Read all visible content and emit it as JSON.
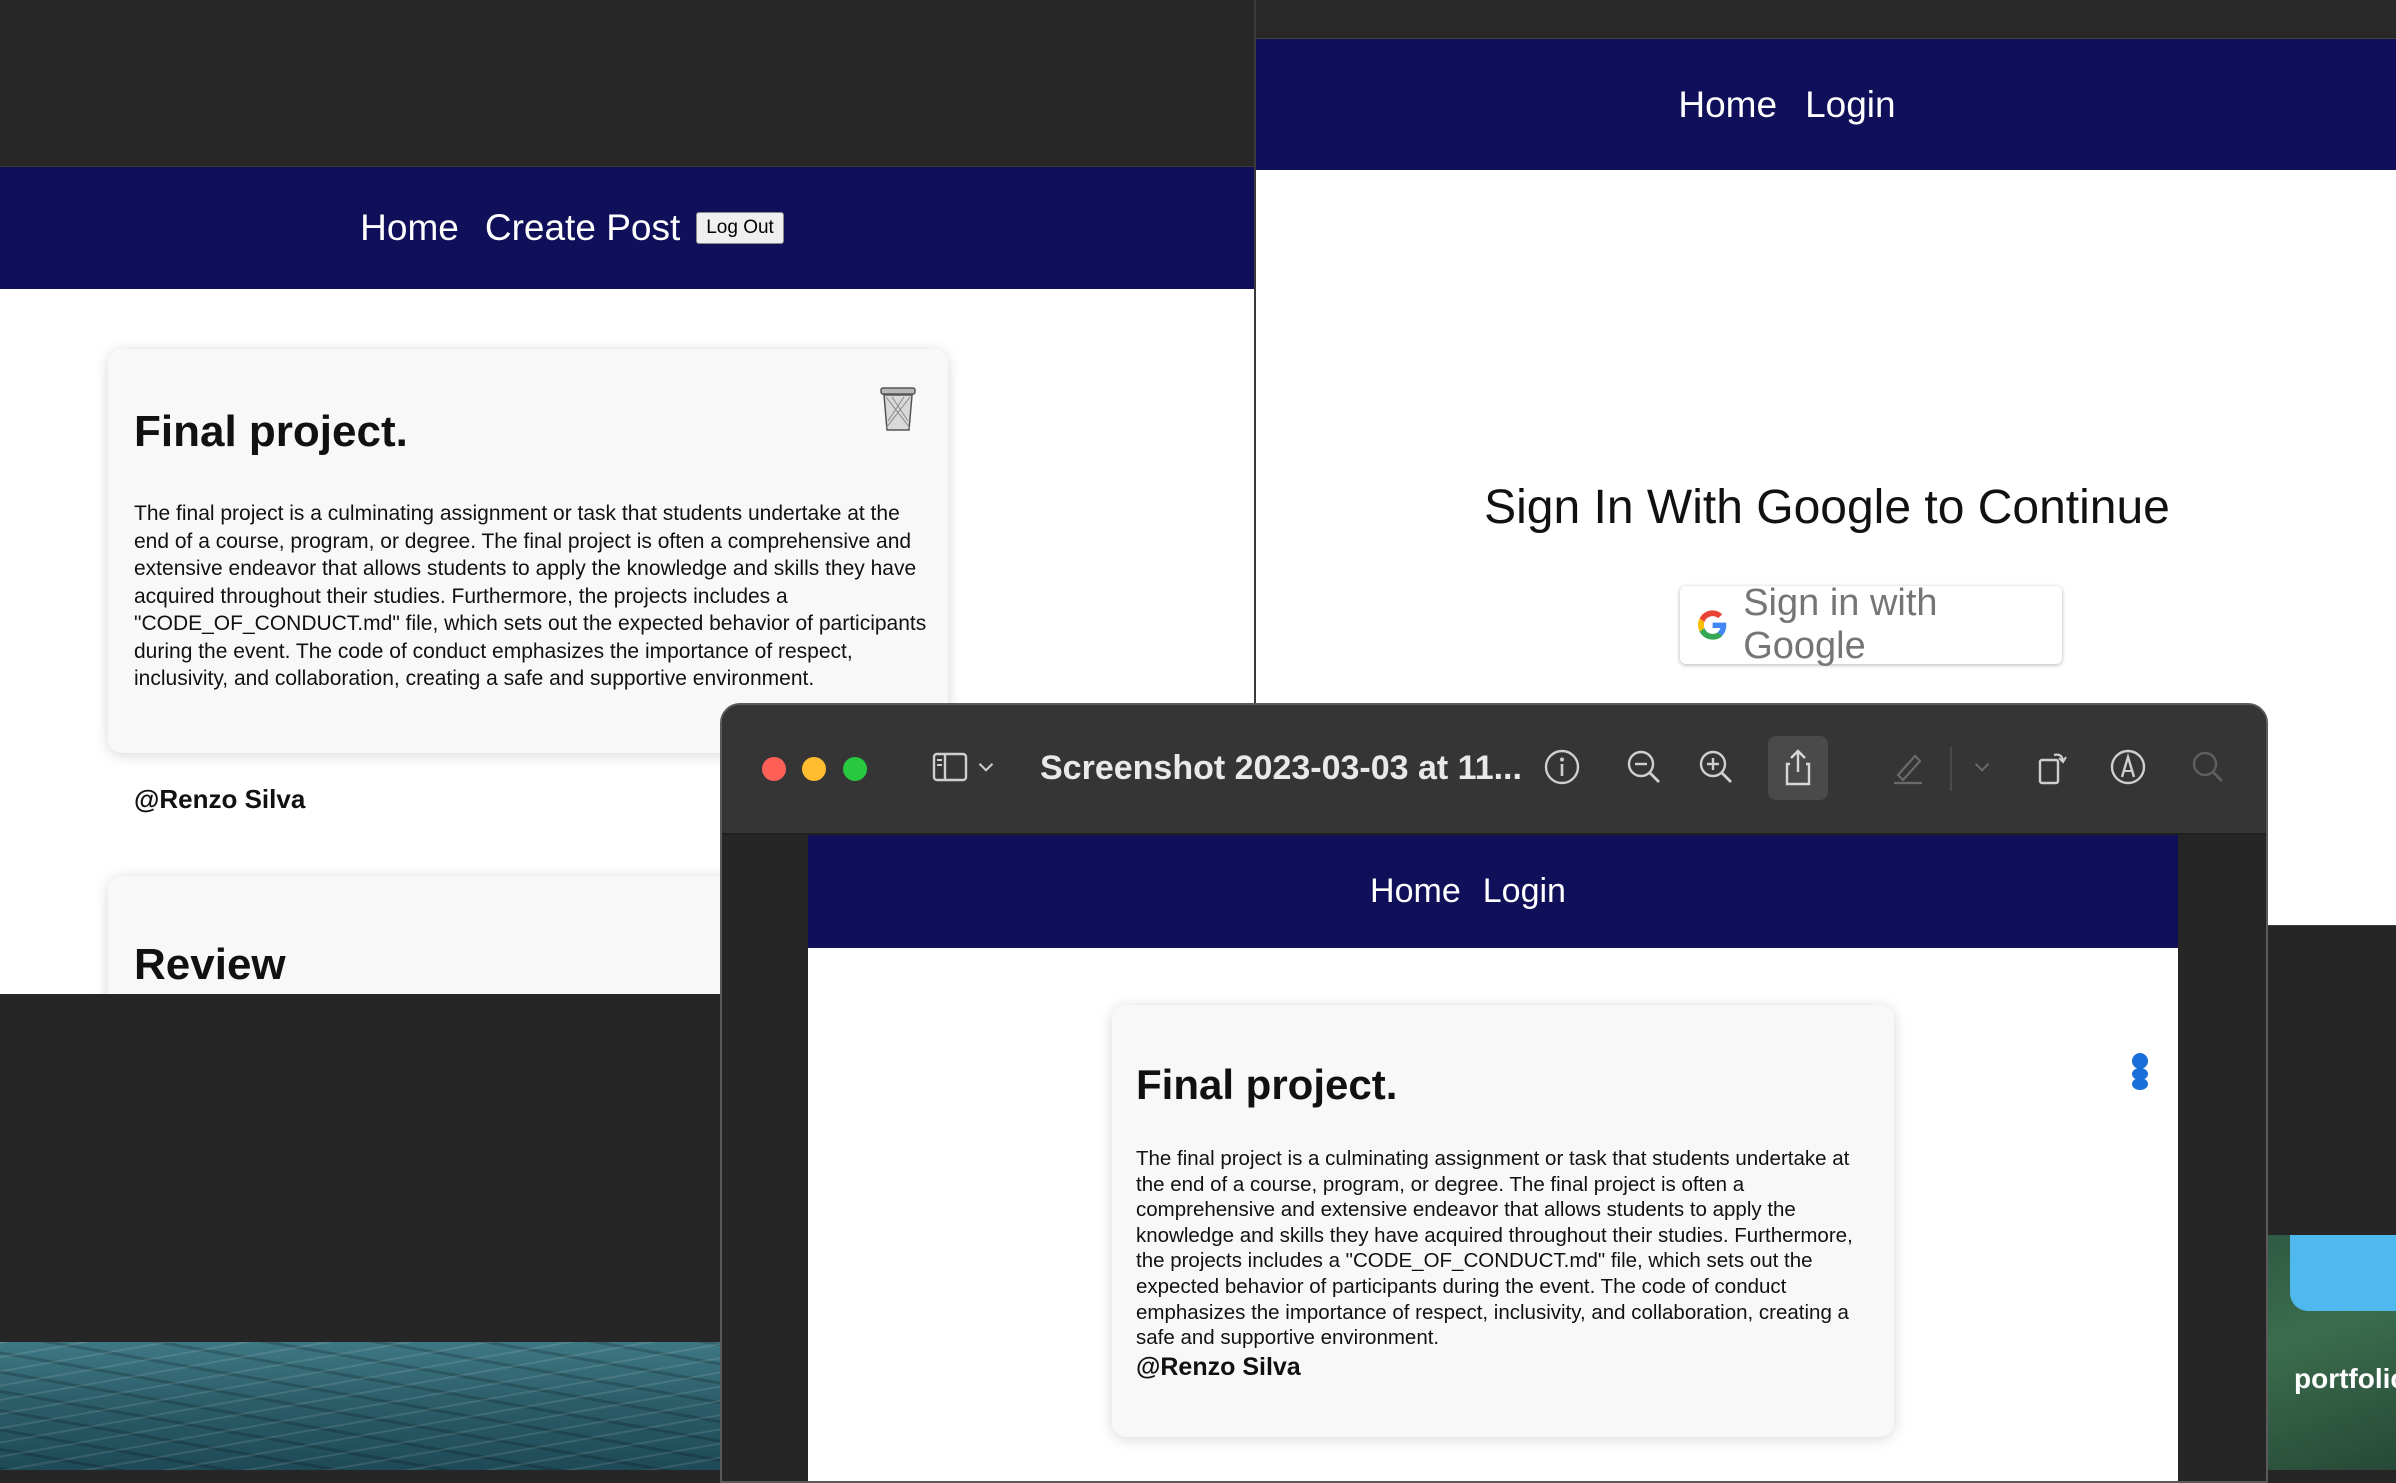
{
  "left_window": {
    "nav": {
      "home": "Home",
      "create_post": "Create Post",
      "logout": "Log Out"
    },
    "posts": [
      {
        "title": "Final project.",
        "body": "The final project is a culminating assignment or task that students undertake at the end of a course, program, or degree. The final project is often a comprehensive and extensive endeavor that allows students to apply the knowledge and skills they have acquired throughout their studies. Furthermore, the projects includes a \"CODE_OF_CONDUCT.md\" file, which sets out the expected behavior of participants during the event. The code of conduct emphasizes the importance of respect, inclusivity, and collaboration, creating a safe and supportive environment.",
        "author": "@Renzo Silva",
        "delete_icon": "trash-icon"
      },
      {
        "title": "Review"
      }
    ]
  },
  "right_window": {
    "nav": {
      "home": "Home",
      "login": "Login"
    },
    "signin_title": "Sign In With Google to Continue",
    "google_button": "Sign in with Google"
  },
  "preview_window": {
    "title": "Screenshot 2023-03-03 at 11...",
    "toolbar_icons": [
      "sidebar-icon",
      "chevron-down-icon",
      "info-icon",
      "zoom-out-icon",
      "zoom-in-icon",
      "share-icon",
      "highlight-icon",
      "chevron-down-icon",
      "rotate-icon",
      "markup-icon",
      "search-icon"
    ],
    "doc": {
      "nav": {
        "home": "Home",
        "login": "Login"
      },
      "post": {
        "title": "Final project.",
        "body": "The final project is a culminating assignment or task that students undertake at the end of a course, program, or degree. The final project is often a comprehensive and extensive endeavor that allows students to apply the knowledge and skills they have acquired throughout their studies. Furthermore, the projects includes a \"CODE_OF_CONDUCT.md\" file, which sets out the expected behavior of participants during the event. The code of conduct emphasizes the importance of respect, inclusivity, and collaboration, creating a safe and supportive environment.",
        "author": "@Renzo Silva"
      }
    }
  },
  "desktop": {
    "folder_label": "portfolic"
  },
  "colors": {
    "nav_bg": "#10105a",
    "window_chrome": "#262626",
    "card_bg": "#f8f8f8"
  }
}
